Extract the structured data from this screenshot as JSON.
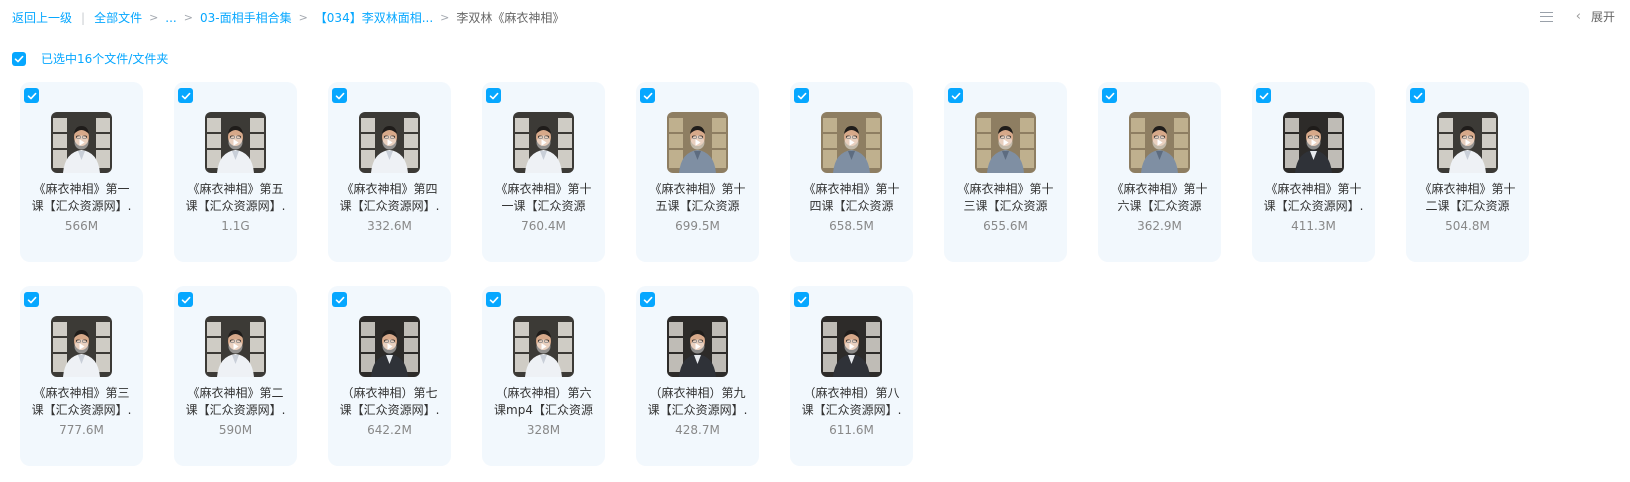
{
  "breadcrumb": {
    "back": "返回上一级",
    "all_files": "全部文件",
    "ellipsis": "...",
    "level1": "03-面相手相合集",
    "level2": "【034】李双林面相...",
    "current": "李双林《麻衣神相》"
  },
  "toolbar": {
    "expand_label": "展开",
    "list_view_icon": "list-view-icon",
    "chevron_icon": "chevron-left-icon"
  },
  "selection": {
    "label": "已选中16个文件/文件夹",
    "checked": true
  },
  "colors": {
    "accent": "#06a7ff",
    "card_bg": "#f2f8fd"
  },
  "files": [
    {
      "name_line1": "《麻衣神相》第一",
      "name_line2": "课【汇众资源网】.",
      "size": "566M",
      "variant": "white"
    },
    {
      "name_line1": "《麻衣神相》第五",
      "name_line2": "课【汇众资源网】.",
      "size": "1.1G",
      "variant": "white"
    },
    {
      "name_line1": "《麻衣神相》第四",
      "name_line2": "课【汇众资源网】.",
      "size": "332.6M",
      "variant": "white"
    },
    {
      "name_line1": "《麻衣神相》第十",
      "name_line2": "一课【汇众资源",
      "size": "760.4M",
      "variant": "white"
    },
    {
      "name_line1": "《麻衣神相》第十",
      "name_line2": "五课【汇众资源",
      "size": "699.5M",
      "variant": "tan"
    },
    {
      "name_line1": "《麻衣神相》第十",
      "name_line2": "四课【汇众资源",
      "size": "658.5M",
      "variant": "tan"
    },
    {
      "name_line1": "《麻衣神相》第十",
      "name_line2": "三课【汇众资源",
      "size": "655.6M",
      "variant": "tan"
    },
    {
      "name_line1": "《麻衣神相》第十",
      "name_line2": "六课【汇众资源",
      "size": "362.9M",
      "variant": "tan"
    },
    {
      "name_line1": "《麻衣神相》第十",
      "name_line2": "课【汇众资源网】.",
      "size": "411.3M",
      "variant": "dark"
    },
    {
      "name_line1": "《麻衣神相》第十",
      "name_line2": "二课【汇众资源",
      "size": "504.8M",
      "variant": "white"
    },
    {
      "name_line1": "《麻衣神相》第三",
      "name_line2": "课【汇众资源网】.",
      "size": "777.6M",
      "variant": "white"
    },
    {
      "name_line1": "《麻衣神相》第二",
      "name_line2": "课【汇众资源网】.",
      "size": "590M",
      "variant": "white"
    },
    {
      "name_line1": "（麻衣神相）第七",
      "name_line2": "课【汇众资源网】.",
      "size": "642.2M",
      "variant": "dark"
    },
    {
      "name_line1": "（麻衣神相）第六",
      "name_line2": "课mp4【汇众资源",
      "size": "328M",
      "variant": "white"
    },
    {
      "name_line1": "（麻衣神相）第九",
      "name_line2": "课【汇众资源网】.",
      "size": "428.7M",
      "variant": "dark"
    },
    {
      "name_line1": "（麻衣神相）第八",
      "name_line2": "课【汇众资源网】.",
      "size": "611.6M",
      "variant": "dark"
    }
  ]
}
